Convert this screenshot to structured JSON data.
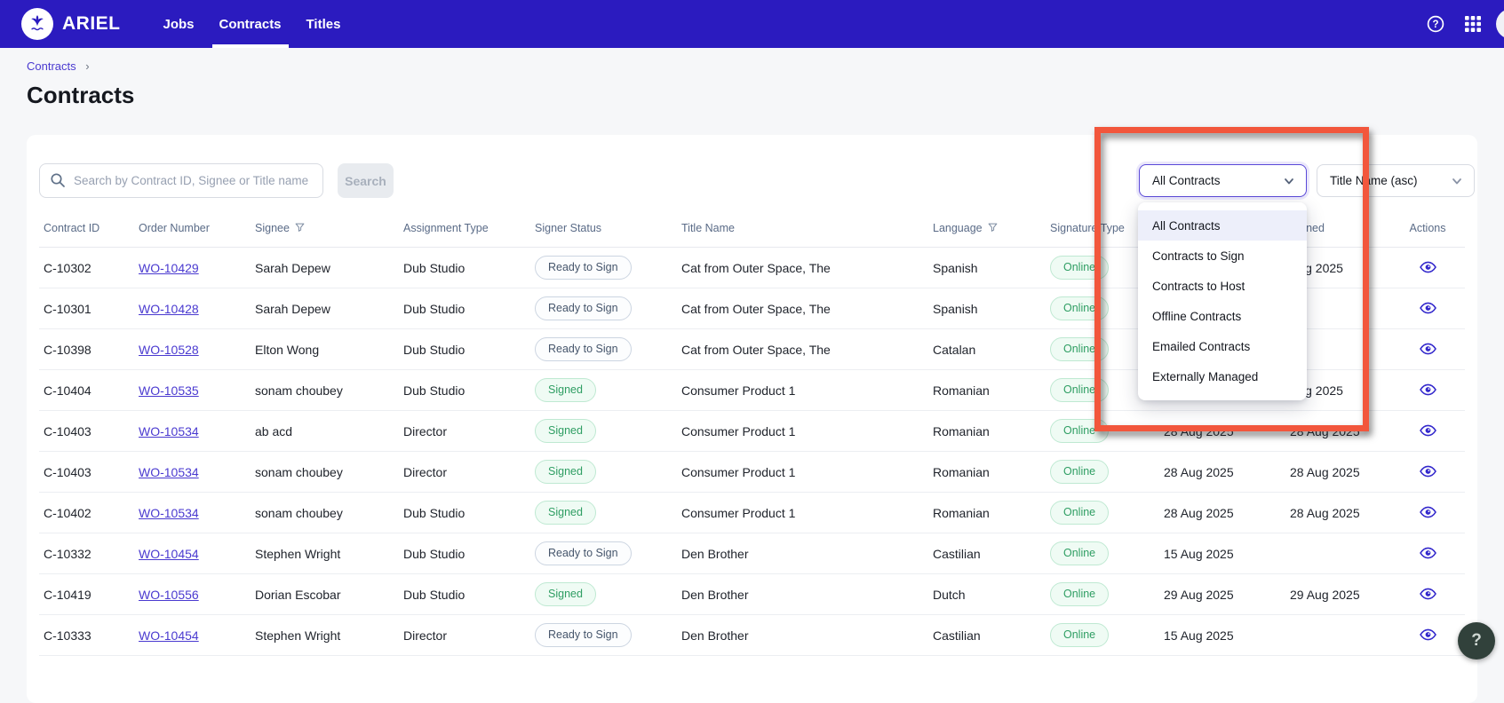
{
  "navbar": {
    "brand": "ARIEL",
    "items": [
      {
        "label": "Jobs",
        "active": false
      },
      {
        "label": "Contracts",
        "active": true
      },
      {
        "label": "Titles",
        "active": false
      }
    ],
    "icons": [
      "whale-tail-logo",
      "help-circle",
      "apps-grid",
      "avatar"
    ]
  },
  "breadcrumb": {
    "items": [
      "Contracts"
    ],
    "separator": "›"
  },
  "page": {
    "title": "Contracts"
  },
  "toolbar": {
    "search_placeholder": "Search by Contract ID, Signee or Title name",
    "search_button": "Search",
    "filter_select_value": "All Contracts",
    "sort_select_value": "Title Name (asc)"
  },
  "filter_dropdown": {
    "selected_index": 0,
    "options": [
      "All Contracts",
      "Contracts to Sign",
      "Contracts to Host",
      "Offline Contracts",
      "Emailed Contracts",
      "Externally Managed"
    ]
  },
  "table": {
    "columns": [
      {
        "label": "Contract ID",
        "filter": false
      },
      {
        "label": "Order Number",
        "filter": false
      },
      {
        "label": "Signee",
        "filter": true
      },
      {
        "label": "Assignment Type",
        "filter": false
      },
      {
        "label": "Signer Status",
        "filter": false
      },
      {
        "label": "Title Name",
        "filter": false
      },
      {
        "label": "Language",
        "filter": true
      },
      {
        "label": "Signature Type",
        "filter": false
      },
      {
        "label": "",
        "filter": false
      },
      {
        "label": "Signed",
        "filter": false
      },
      {
        "label": "Actions",
        "filter": false
      }
    ],
    "rows": [
      {
        "contract_id": "C-10302",
        "order_number": "WO-10429",
        "signee": "Sarah Depew",
        "assignment_type": "Dub Studio",
        "signer_status": "Ready to Sign",
        "title_name": "Cat from Outer Space, The",
        "language": "Spanish",
        "signature_type": "Online",
        "date_1": "",
        "date_2": "Aug 2025"
      },
      {
        "contract_id": "C-10301",
        "order_number": "WO-10428",
        "signee": "Sarah Depew",
        "assignment_type": "Dub Studio",
        "signer_status": "Ready to Sign",
        "title_name": "Cat from Outer Space, The",
        "language": "Spanish",
        "signature_type": "Online",
        "date_1": "",
        "date_2": ""
      },
      {
        "contract_id": "C-10398",
        "order_number": "WO-10528",
        "signee": "Elton Wong",
        "assignment_type": "Dub Studio",
        "signer_status": "Ready to Sign",
        "title_name": "Cat from Outer Space, The",
        "language": "Catalan",
        "signature_type": "Online",
        "date_1": "",
        "date_2": ""
      },
      {
        "contract_id": "C-10404",
        "order_number": "WO-10535",
        "signee": "sonam choubey",
        "assignment_type": "Dub Studio",
        "signer_status": "Signed",
        "title_name": "Consumer Product 1",
        "language": "Romanian",
        "signature_type": "Online",
        "date_1": "",
        "date_2": "Aug 2025"
      },
      {
        "contract_id": "C-10403",
        "order_number": "WO-10534",
        "signee": "ab acd",
        "assignment_type": "Director",
        "signer_status": "Signed",
        "title_name": "Consumer Product 1",
        "language": "Romanian",
        "signature_type": "Online",
        "date_1": "28 Aug 2025",
        "date_2": "28 Aug 2025"
      },
      {
        "contract_id": "C-10403",
        "order_number": "WO-10534",
        "signee": "sonam choubey",
        "assignment_type": "Director",
        "signer_status": "Signed",
        "title_name": "Consumer Product 1",
        "language": "Romanian",
        "signature_type": "Online",
        "date_1": "28 Aug 2025",
        "date_2": "28 Aug 2025"
      },
      {
        "contract_id": "C-10402",
        "order_number": "WO-10534",
        "signee": "sonam choubey",
        "assignment_type": "Dub Studio",
        "signer_status": "Signed",
        "title_name": "Consumer Product 1",
        "language": "Romanian",
        "signature_type": "Online",
        "date_1": "28 Aug 2025",
        "date_2": "28 Aug 2025"
      },
      {
        "contract_id": "C-10332",
        "order_number": "WO-10454",
        "signee": "Stephen Wright",
        "assignment_type": "Dub Studio",
        "signer_status": "Ready to Sign",
        "title_name": "Den Brother",
        "language": "Castilian",
        "signature_type": "Online",
        "date_1": "15 Aug 2025",
        "date_2": ""
      },
      {
        "contract_id": "C-10419",
        "order_number": "WO-10556",
        "signee": "Dorian Escobar",
        "assignment_type": "Dub Studio",
        "signer_status": "Signed",
        "title_name": "Den Brother",
        "language": "Dutch",
        "signature_type": "Online",
        "date_1": "29 Aug 2025",
        "date_2": "29 Aug 2025"
      },
      {
        "contract_id": "C-10333",
        "order_number": "WO-10454",
        "signee": "Stephen Wright",
        "assignment_type": "Director",
        "signer_status": "Ready to Sign",
        "title_name": "Den Brother",
        "language": "Castilian",
        "signature_type": "Online",
        "date_1": "15 Aug 2025",
        "date_2": ""
      }
    ]
  },
  "annotation": {
    "highlight_color": "#f2563c"
  },
  "floating_button": {
    "glyph": "?"
  },
  "colors": {
    "navbar": "#2b1bbf",
    "link": "#4a3ad0",
    "badge_green_text": "#2f9e63",
    "badge_gray_text": "#45556b",
    "select_focus_border": "#5a49d8",
    "annotation_red": "#f2563c"
  }
}
